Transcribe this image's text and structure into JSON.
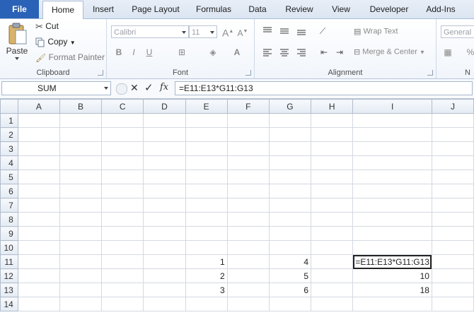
{
  "tabs": {
    "file": "File",
    "home": "Home",
    "insert": "Insert",
    "page_layout": "Page Layout",
    "formulas": "Formulas",
    "data": "Data",
    "review": "Review",
    "view": "View",
    "developer": "Developer",
    "addins": "Add-Ins"
  },
  "ribbon": {
    "clipboard": {
      "label": "Clipboard",
      "paste": "Paste",
      "cut": "Cut",
      "copy": "Copy",
      "format_painter": "Format Painter"
    },
    "font": {
      "label": "Font",
      "name": "Calibri",
      "size": "11"
    },
    "alignment": {
      "label": "Alignment",
      "wrap_text": "Wrap Text",
      "merge_center": "Merge & Center"
    },
    "number": {
      "format": "General",
      "label_partial": "N"
    }
  },
  "formula_bar": {
    "name_box": "SUM",
    "fx": "fx",
    "content": "=E11:E13*G11:G13"
  },
  "grid": {
    "columns": [
      "A",
      "B",
      "C",
      "D",
      "E",
      "F",
      "G",
      "H",
      "I",
      "J"
    ],
    "rows": [
      "1",
      "2",
      "3",
      "4",
      "5",
      "6",
      "7",
      "8",
      "9",
      "10",
      "11",
      "12",
      "13",
      "14"
    ],
    "cells": {
      "E11": "1",
      "E12": "2",
      "E13": "3",
      "G11": "4",
      "G12": "5",
      "G13": "6",
      "I11": "=E11:E13*G11:G13",
      "I12": "10",
      "I13": "18"
    }
  }
}
